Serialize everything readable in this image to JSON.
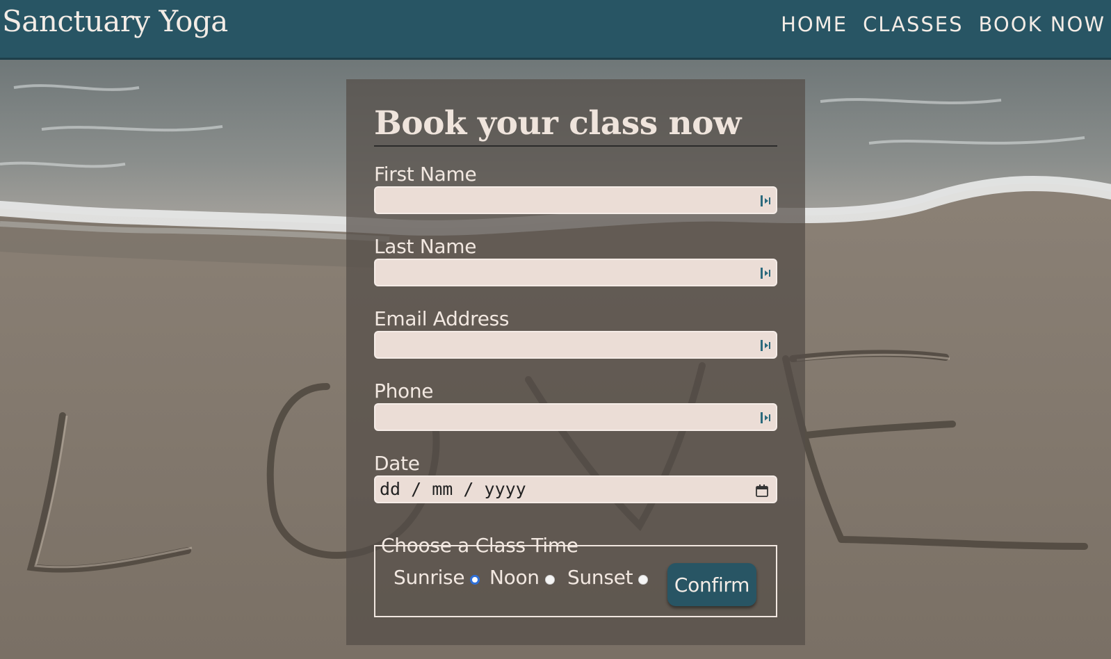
{
  "header": {
    "brand": "Sanctuary Yoga",
    "nav": [
      {
        "label": "HOME"
      },
      {
        "label": "CLASSES"
      },
      {
        "label": "BOOK NOW"
      }
    ]
  },
  "form": {
    "title": "Book your class now",
    "fields": [
      {
        "label": "First Name",
        "value": ""
      },
      {
        "label": "Last Name",
        "value": ""
      },
      {
        "label": "Email Address",
        "value": ""
      },
      {
        "label": "Phone",
        "value": ""
      }
    ],
    "date": {
      "label": "Date",
      "placeholder": "dd / mm / yyyy"
    },
    "class_time": {
      "legend": "Choose a Class Time",
      "options": [
        {
          "label": "Sunrise",
          "checked": true
        },
        {
          "label": "Noon",
          "checked": false
        },
        {
          "label": "Sunset",
          "checked": false
        }
      ]
    },
    "confirm_label": "Confirm"
  },
  "colors": {
    "header_bg": "#285564",
    "button_bg": "#285564",
    "input_bg": "#ebddd6",
    "panel_bg": "rgba(84,78,72,0.72)"
  }
}
